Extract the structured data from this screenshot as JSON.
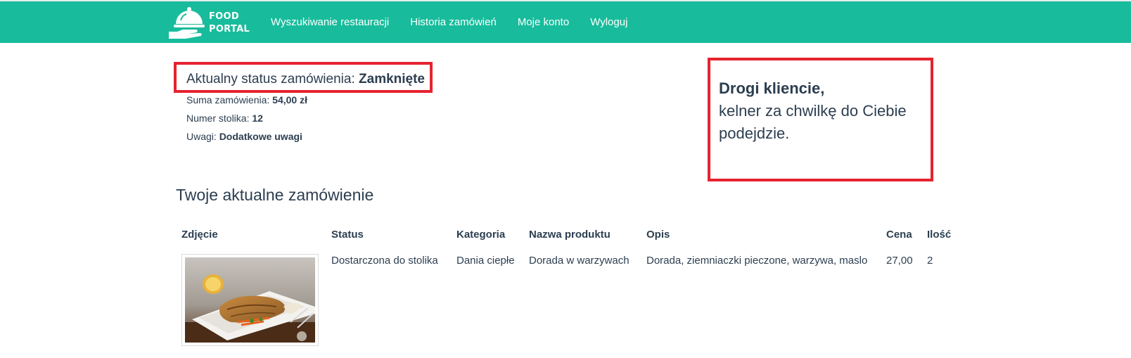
{
  "brand": {
    "line1": "FOOD",
    "line2": "PORTAL",
    "logo_icon": "cloche-hand-icon"
  },
  "nav": [
    {
      "label": "Wyszukiwanie restauracji"
    },
    {
      "label": "Historia zamówień"
    },
    {
      "label": "Moje konto"
    },
    {
      "label": "Wyloguj"
    }
  ],
  "order": {
    "status_label": "Aktualny status zamówienia:",
    "status_value": "Zamknięte",
    "sum_label": "Suma zamówienia:",
    "sum_value": "54,00 zł",
    "table_label": "Numer stolika:",
    "table_value": "12",
    "notes_label": "Uwagi:",
    "notes_value": "Dodatkowe uwagi"
  },
  "notice": {
    "greeting": "Drogi kliencie,",
    "message": "kelner za chwilkę do Ciebie podejdzie."
  },
  "section_title": "Twoje aktualne zamówienie",
  "table": {
    "headers": [
      "Zdjęcie",
      "Status",
      "Kategoria",
      "Nazwa produktu",
      "Opis",
      "Cena",
      "Ilość"
    ],
    "rows": [
      {
        "image": "fish-dish-photo",
        "status": "Dostarczona do stolika",
        "category": "Dania ciepłe",
        "name": "Dorada w warzywach",
        "description": "Dorada, ziemniaczki pieczone, warzywa, maslo",
        "price": "27,00",
        "quantity": "2"
      }
    ]
  },
  "colors": {
    "navbar": "#18bc9c",
    "highlight_border": "#e52330",
    "text": "#2c3e50"
  }
}
